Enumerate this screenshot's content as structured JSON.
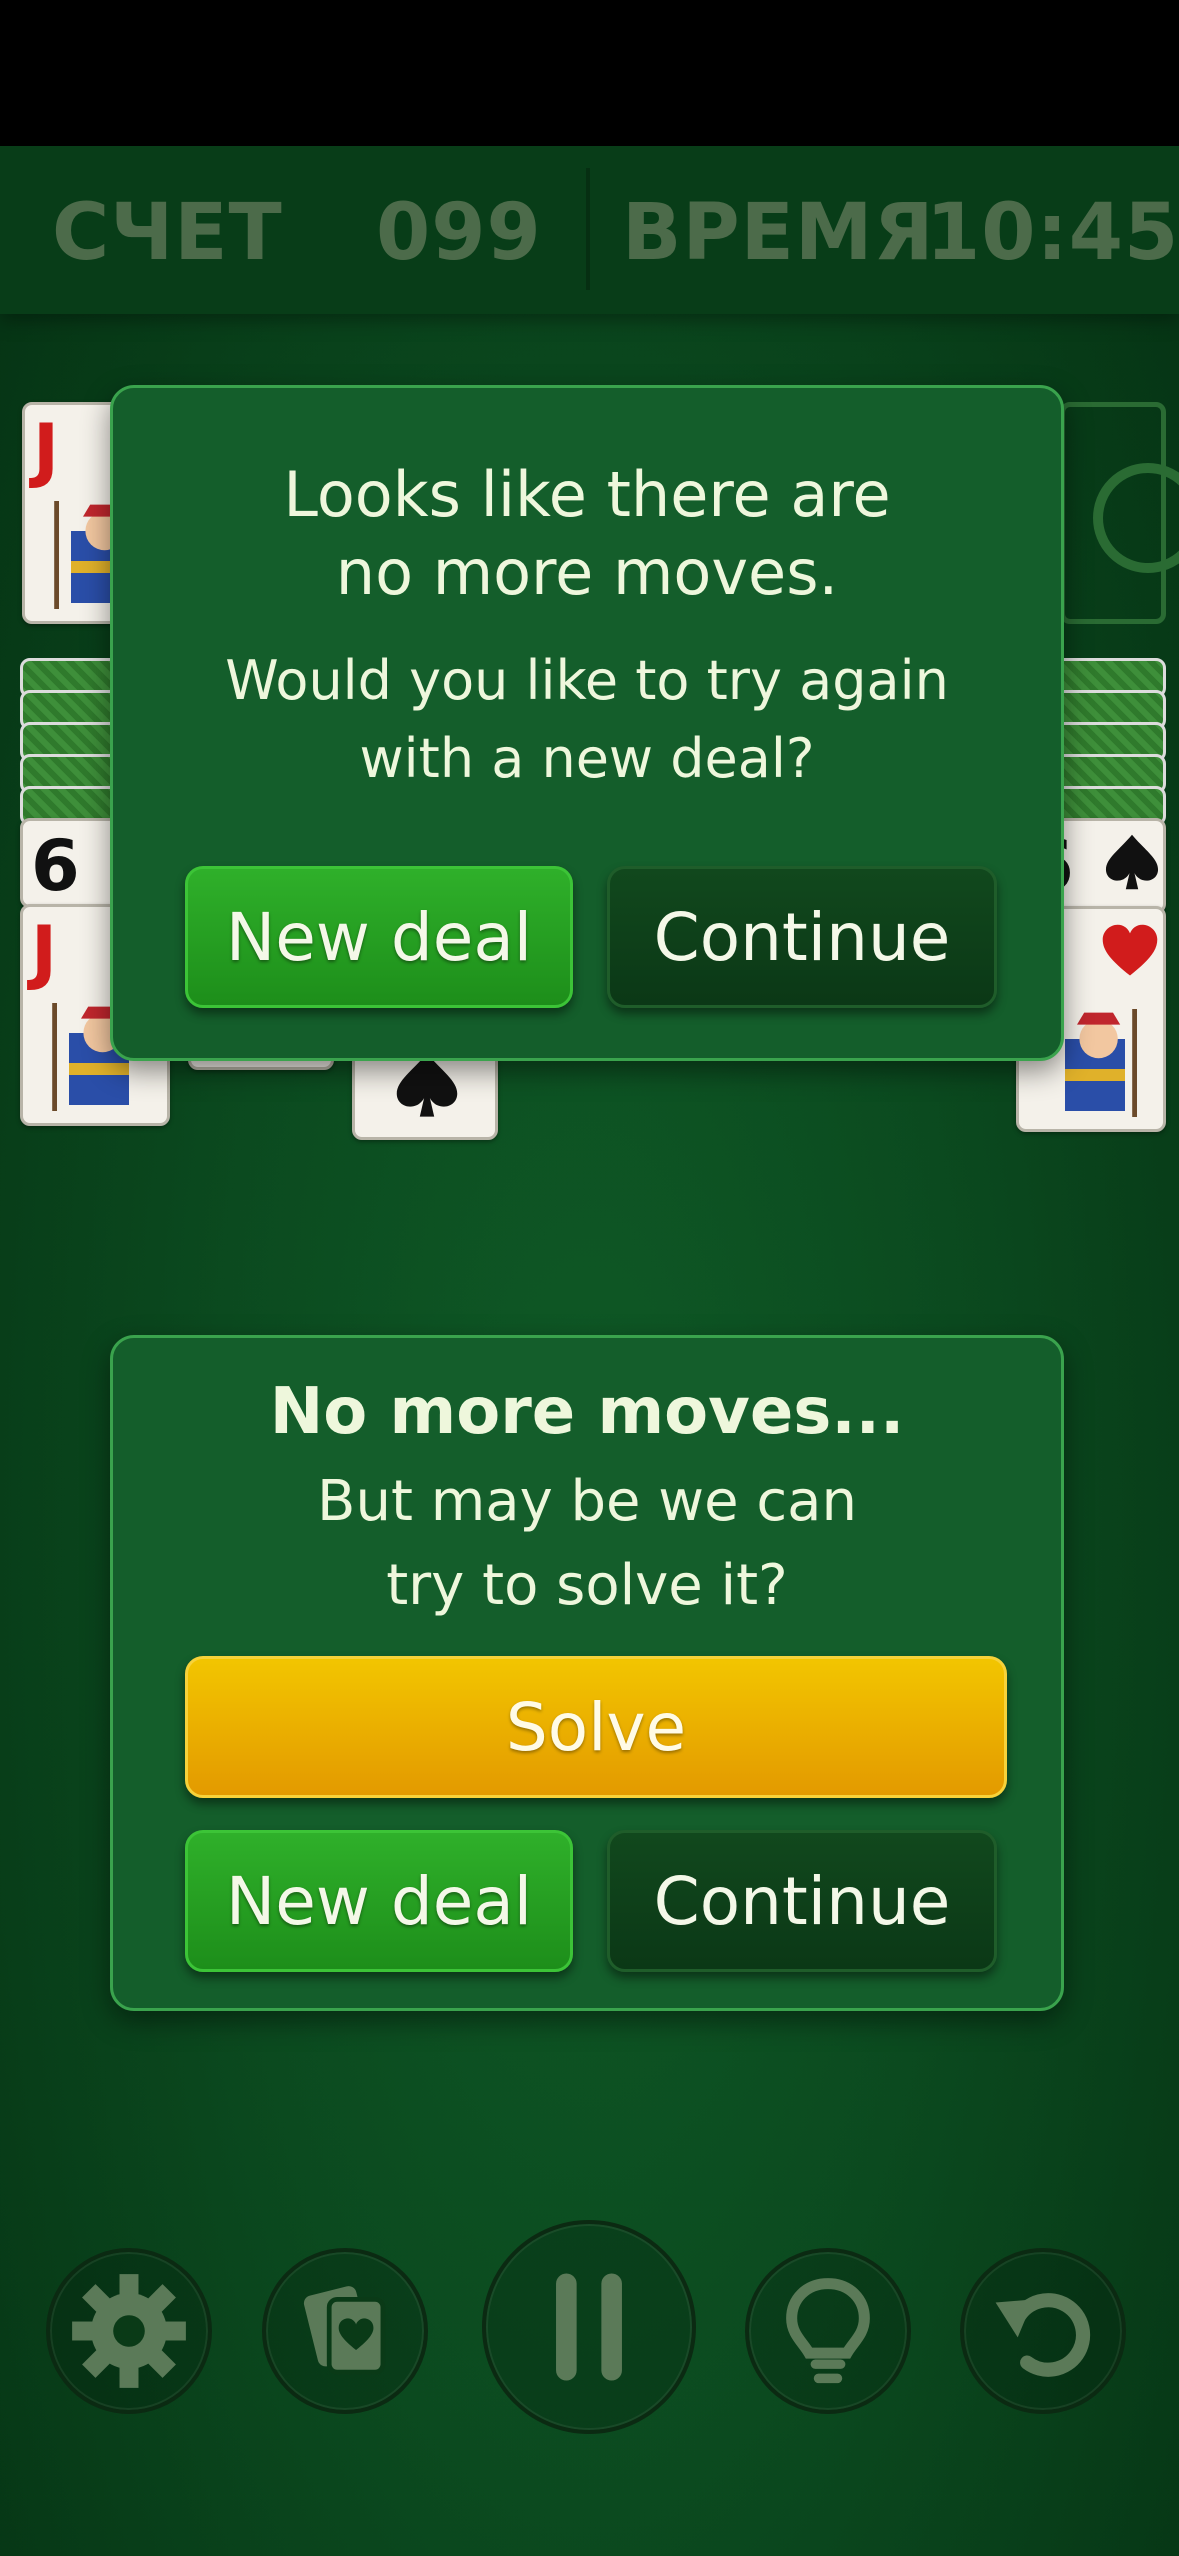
{
  "header": {
    "score_label": "СЧЕТ",
    "score_value": "099",
    "time_label": "ВРЕМЯ",
    "time_value": "10:45"
  },
  "board": {
    "left_top_card": {
      "rank": "J",
      "suit": "hearts"
    },
    "left_pile_visible": [
      {
        "rank": "6",
        "suit": "spades"
      },
      {
        "rank": "J",
        "suit": "hearts"
      }
    ],
    "right_pile_visible": [
      {
        "rank": "6",
        "suit": "spades"
      },
      {
        "rank": "J",
        "suit": "hearts"
      }
    ],
    "center_card_suit": "spades"
  },
  "dialog_top": {
    "line1": "Looks like there are",
    "line2": "no more moves.",
    "line3": "Would you like to try again",
    "line4": "with a new deal?",
    "new_deal_label": "New deal",
    "continue_label": "Continue"
  },
  "dialog_bottom": {
    "title": "No more moves...",
    "line1": "But may be we can",
    "line2": "try to solve it?",
    "solve_label": "Solve",
    "new_deal_label": "New deal",
    "continue_label": "Continue"
  },
  "toolbar": {
    "icons": [
      "gear-icon",
      "cards-icon",
      "pause-icon",
      "lightbulb-icon",
      "undo-icon"
    ]
  },
  "colors": {
    "felt": "#0b4a1f",
    "dialog": "#145e2b",
    "green_button": "#2fb02a",
    "dark_button": "#11481d",
    "yellow_button": "#f2c500"
  }
}
